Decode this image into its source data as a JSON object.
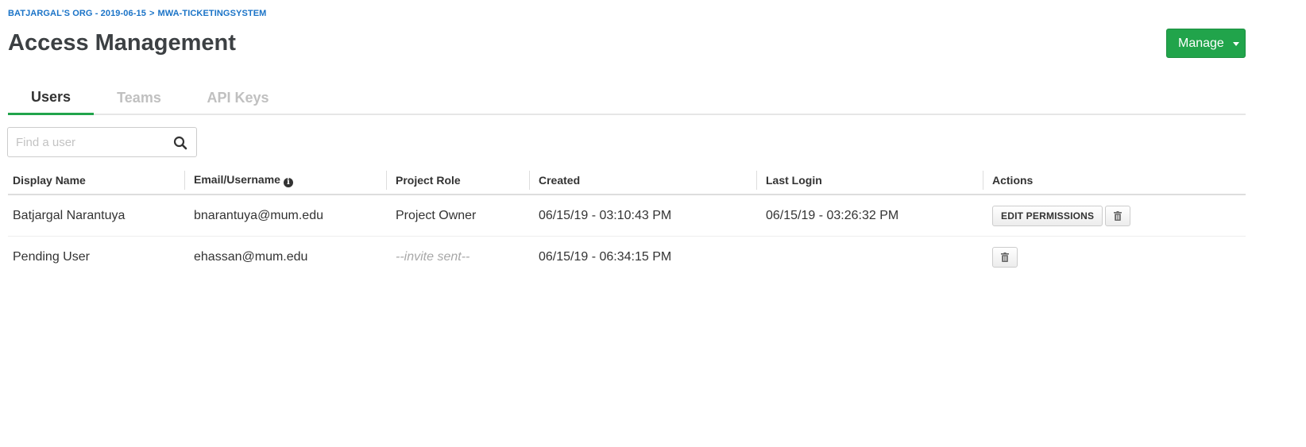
{
  "breadcrumb": {
    "org": "BATJARGAL'S ORG - 2019-06-15",
    "separator": ">",
    "project": "MWA-TICKETINGSYSTEM"
  },
  "page": {
    "title": "Access Management"
  },
  "header": {
    "manage_label": "Manage"
  },
  "tabs": [
    {
      "label": "Users",
      "active": true
    },
    {
      "label": "Teams",
      "active": false
    },
    {
      "label": "API Keys",
      "active": false
    }
  ],
  "search": {
    "placeholder": "Find a user",
    "value": ""
  },
  "table": {
    "columns": [
      "Display Name",
      "Email/Username",
      "Project Role",
      "Created",
      "Last Login",
      "Actions"
    ],
    "rows": [
      {
        "display_name": "Batjargal Narantuya",
        "email": "bnarantuya@mum.edu",
        "role": "Project Owner",
        "created": "06/15/19 - 03:10:43 PM",
        "last_login": "06/15/19 - 03:26:32 PM",
        "edit_label": "EDIT PERMISSIONS"
      },
      {
        "display_name": "Pending User",
        "email": "ehassan@mum.edu",
        "role": "--invite sent--",
        "created": "06/15/19 - 06:34:15 PM",
        "last_login": ""
      }
    ]
  },
  "colors": {
    "accent_green": "#21a44b",
    "link_blue": "#1a73c7",
    "muted_text": "#a8a8a8"
  },
  "icons": {
    "search": "search-icon",
    "info": "info-icon",
    "trash": "trash-icon",
    "caret": "caret-down-icon"
  }
}
